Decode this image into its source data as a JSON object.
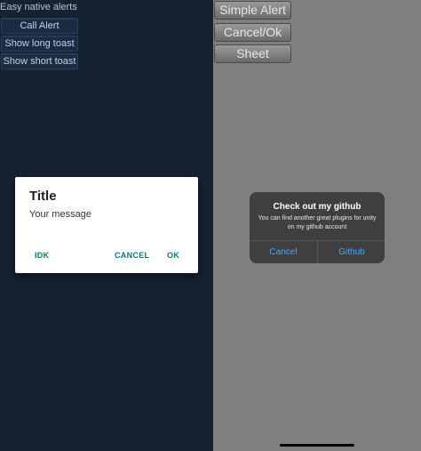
{
  "android": {
    "app_title": "Easy native alerts",
    "buttons": {
      "call_alert": "Call Alert",
      "show_long_toast": "Show long toast",
      "show_short_toast": "Show short toast"
    },
    "dialog": {
      "title": "Title",
      "message": "Your message",
      "actions": {
        "neutral": "IDK",
        "negative": "CANCEL",
        "positive": "OK"
      },
      "accent_color": "#0b7a73"
    },
    "background_color": "#142234"
  },
  "ios": {
    "buttons": {
      "simple_alert": "Simple Alert",
      "cancel_ok": "Cancel/Ok",
      "sheet": "Sheet"
    },
    "alert": {
      "title": "Check out my github",
      "message": "You can find another great plugins for unity on my github account",
      "cancel": "Cancel",
      "github": "Github",
      "button_color": "#4aa3ff"
    },
    "background_color": "#7f7f7f"
  }
}
